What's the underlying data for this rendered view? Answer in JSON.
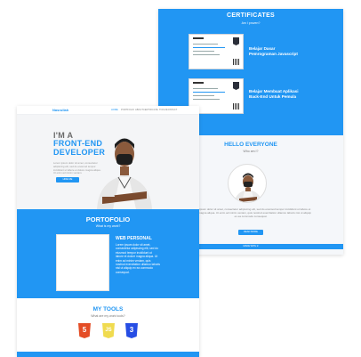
{
  "certificates": {
    "title": "CERTIFICATES",
    "subtitle": "Am I proven?",
    "items": [
      {
        "label_line1": "Belajar Dasar",
        "label_line2": "Pemrograman Javascript"
      },
      {
        "label_line1": "Belajar Membuat Aplikasi",
        "label_line2": "Back-End Untuk Pemula"
      }
    ]
  },
  "hello": {
    "title": "HELLO EVERYONE",
    "subtitle": "Who am I?",
    "text": "Lorem ipsum dolor sit amet, consectetur adipiscing elit, sed do eiusmod tempor incididunt ut labore et dolore magna aliqua. Ut enim ad minim veniam, quis nostrud exercitation ullamco laboris nisi ut aliquip ex ea commodo consequat.",
    "button": "READ MORE"
  },
  "footer_right": {
    "text": "MADE WITH ♥"
  },
  "nav": {
    "brand": "Nasrullah",
    "links": [
      "HOME",
      "PORTFOLIO",
      "ABOUT",
      "CERTIFICATE",
      "TOOLS",
      "CONTACT"
    ]
  },
  "hero": {
    "line1": "I'M A",
    "line2": "FRONT-END",
    "line3": "DEVELOPER",
    "paragraph": "Lorem ipsum dolor sit amet, consectetur adipiscing elit, sed do eiusmod tempor incididunt ut labore et dolore magna aliqua. Ut enim ad minim veniam.",
    "button": "HIRE ME"
  },
  "portfolio": {
    "title": "PORTOFOLIO",
    "subtitle": "What is my work?",
    "project_title": "WEB PERSONAL",
    "project_desc": "Lorem ipsum dolor sit amet, consectetur adipiscing elit, sed do eiusmod tempor incididunt ut labore et dolore magna aliqua. Ut enim ad minim veniam, quis nostrud exercitation ullamco laboris nisi ut aliquip ex ea commodo consequat."
  },
  "tools": {
    "title": "MY TOOLS",
    "subtitle": "What are my work tools?",
    "items": [
      {
        "name": "html5-icon",
        "glyph": "5",
        "color": "#e44d26"
      },
      {
        "name": "javascript-icon",
        "glyph": "JS",
        "color": "#f0db4f"
      },
      {
        "name": "css3-icon",
        "glyph": "3",
        "color": "#264de4"
      }
    ]
  },
  "colors": {
    "accent": "#2196f3"
  }
}
